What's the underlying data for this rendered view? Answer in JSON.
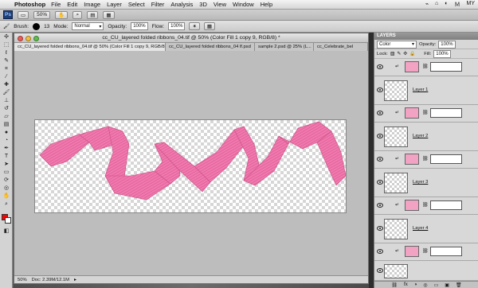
{
  "menubar": {
    "apple": "",
    "app": "Photoshop",
    "items": [
      "File",
      "Edit",
      "Image",
      "Layer",
      "Select",
      "Filter",
      "Analysis",
      "3D",
      "View",
      "Window",
      "Help"
    ],
    "right": [
      "⌁",
      "⌂",
      "◐",
      "Ｍ",
      "MY"
    ]
  },
  "appbar": {
    "logo": "Ps",
    "zoom": "50%",
    "buttons": [
      "▭",
      "✋",
      "⌕",
      "▤",
      "▦"
    ]
  },
  "options": {
    "tool_label": "Brush:",
    "brush_size": "13",
    "mode_label": "Mode:",
    "mode_value": "Normal",
    "opacity_label": "Opacity:",
    "opacity_value": "100%",
    "flow_label": "Flow:",
    "flow_value": "100%"
  },
  "document": {
    "title": "cc_CU_layered folded ribbons_04.tif @ 50% (Color Fill 1 copy 9, RGB/8) *",
    "tabs": [
      "cc_CU_layered folded ribbons_04.tif @ 50% (Color Fill 1 copy 9, RGB/8) *",
      "cc_CU_layered folded ribbons_04 lf.psd",
      "sample 2.psd @ 25% (L...",
      "cc_Celebrate_bel"
    ],
    "status_zoom": "50%",
    "status_doc": "Doc: 2.39M/12.1M"
  },
  "layers_panel": {
    "title": "LAYERS",
    "blend_mode": "Color",
    "opacity_label": "Opacity:",
    "opacity_value": "100%",
    "lock_label": "Lock:",
    "fill_label": "Fill:",
    "fill_value": "100%",
    "layers": [
      {
        "name": "",
        "kind": "fill"
      },
      {
        "name": "Layer 1",
        "kind": "ribbon"
      },
      {
        "name": "",
        "kind": "fill"
      },
      {
        "name": "Layer 2",
        "kind": "ribbon"
      },
      {
        "name": "",
        "kind": "fill"
      },
      {
        "name": "Layer 3",
        "kind": "ribbon"
      },
      {
        "name": "",
        "kind": "fill"
      },
      {
        "name": "Layer 4",
        "kind": "ribbon"
      },
      {
        "name": "",
        "kind": "fill"
      },
      {
        "name": "",
        "kind": "ribbon"
      }
    ],
    "footer_icons": [
      "⛓",
      "fx",
      "◑",
      "◎",
      "▭",
      "▣",
      "🗑"
    ]
  },
  "colors": {
    "ribbon_pink": "#f07ab0",
    "fill_thumb": "#f2a3c4",
    "foreground": "#ff0000",
    "background": "#ffffff"
  }
}
